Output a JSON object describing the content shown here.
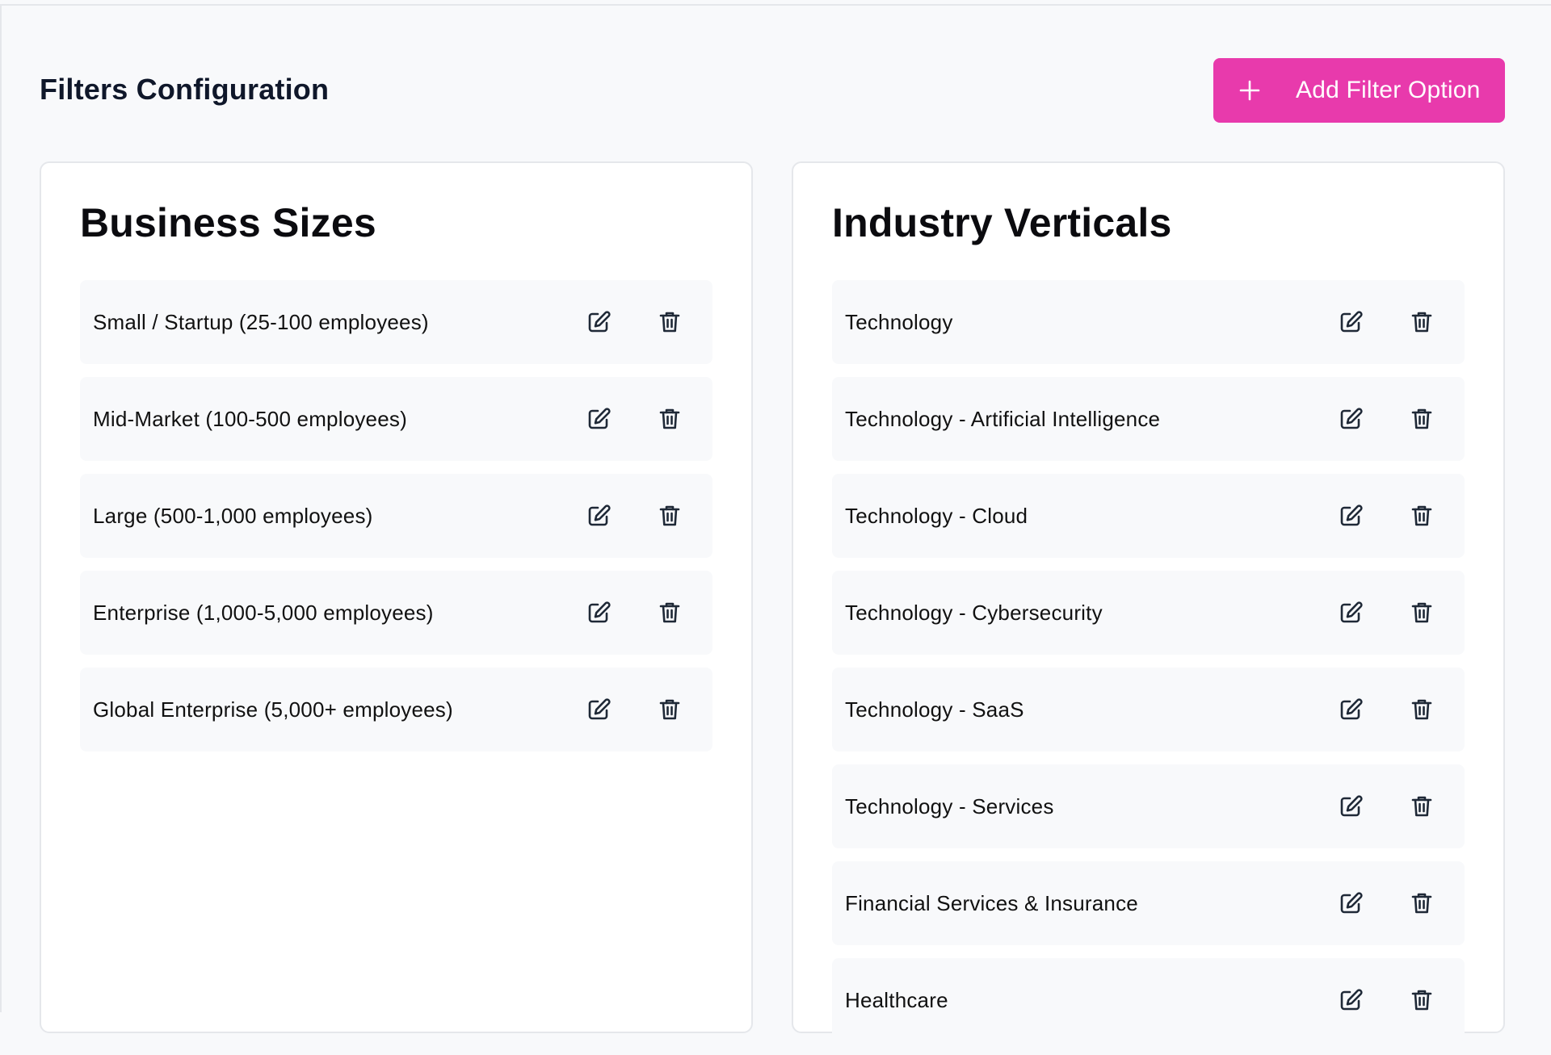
{
  "page": {
    "title": "Filters Configuration"
  },
  "add_button": {
    "label": "Add Filter Option",
    "icon": "plus-icon",
    "color": "#e83aac"
  },
  "business_sizes": {
    "title": "Business Sizes",
    "items": [
      {
        "label": "Small / Startup (25-100 employees)"
      },
      {
        "label": "Mid-Market (100-500 employees)"
      },
      {
        "label": "Large (500-1,000 employees)"
      },
      {
        "label": "Enterprise (1,000-5,000 employees)"
      },
      {
        "label": "Global Enterprise (5,000+ employees)"
      }
    ]
  },
  "industry_verticals": {
    "title": "Industry Verticals",
    "items": [
      {
        "label": "Technology"
      },
      {
        "label": "Technology - Artificial Intelligence"
      },
      {
        "label": "Technology - Cloud"
      },
      {
        "label": "Technology - Cybersecurity"
      },
      {
        "label": "Technology - SaaS"
      },
      {
        "label": "Technology - Services"
      },
      {
        "label": "Financial Services & Insurance"
      },
      {
        "label": "Healthcare"
      }
    ]
  },
  "row_actions": {
    "edit_icon": "edit-icon",
    "delete_icon": "trash-icon"
  }
}
